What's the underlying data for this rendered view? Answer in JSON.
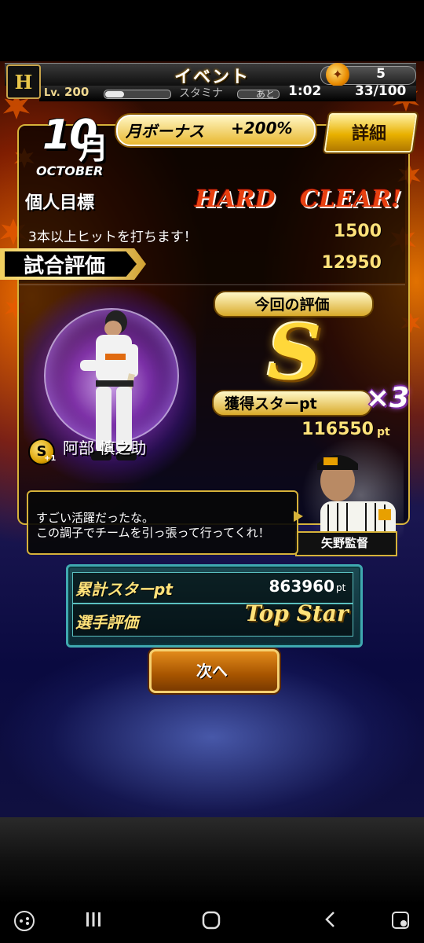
{
  "header": {
    "logo_text": "H",
    "title": "イベント",
    "ticket_count": "5",
    "level_label": "Lv.",
    "level_value": "200",
    "stamina_label": "スタミナ",
    "ato_label": "あと",
    "timer": "1:02",
    "stamina_count": "33/100"
  },
  "month": {
    "number": "10",
    "kanji": "月",
    "english": "OCTOBER"
  },
  "bonus": {
    "label": "月ボーナス",
    "value": "+200%"
  },
  "detail_button": "詳細",
  "personal_goal": {
    "label": "個人目標",
    "difficulty": "HARD",
    "result": "CLEAR!",
    "description": "3本以上ヒットを打ちます！",
    "points": "1500"
  },
  "match_eval": {
    "label": "試合評価",
    "points": "12950"
  },
  "this_eval": {
    "label": "今回の評価",
    "grade": "S"
  },
  "star_pt": {
    "label": "獲得スターpt",
    "multiplier": "×3",
    "value": "116550",
    "unit": "pt"
  },
  "player": {
    "name": "阿部 慎之助",
    "badge": "S",
    "badge_sub": "+1"
  },
  "manager": {
    "name": "矢野監督",
    "message_line1": "すごい活躍だったな。",
    "message_line2": "この調子でチームを引っ張って行ってくれ！"
  },
  "cumulative": {
    "label": "累計スターpt",
    "value": "863960",
    "unit": "pt",
    "rating_label": "選手評価",
    "rating_value": "Top Star"
  },
  "next_button": "次へ",
  "colors": {
    "gold": "#d6b23a",
    "accent_orange": "#e84010",
    "teal": "#3fa9b0"
  }
}
